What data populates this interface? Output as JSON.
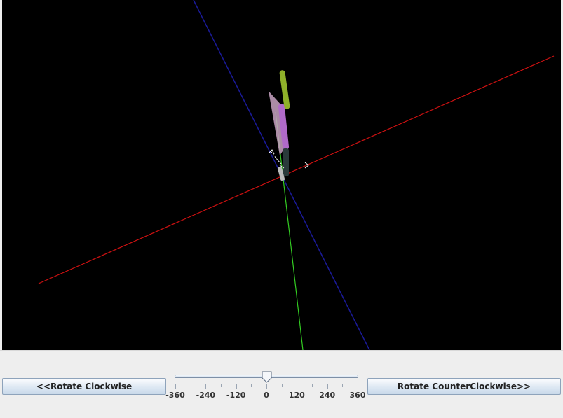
{
  "buttons": {
    "rotate_clockwise": "<<Rotate Clockwise",
    "rotate_counterclockwise": "Rotate CounterClockwise>>"
  },
  "slider": {
    "min": -360,
    "max": 360,
    "value": 0,
    "labels": [
      "-360",
      "-240",
      "-120",
      "0",
      "120",
      "240",
      "360"
    ]
  },
  "scene": {
    "background": "#000000",
    "axis_colors": {
      "x": "#cc1111",
      "y": "#33cc22",
      "z": "#1a1a99"
    },
    "arm_colors": {
      "segment1": "#c9a3c3",
      "segment2": "#b06ac9",
      "segment3": "#8fb02a",
      "base": "#2a3a3a",
      "joint": "#bbbbbb"
    }
  }
}
